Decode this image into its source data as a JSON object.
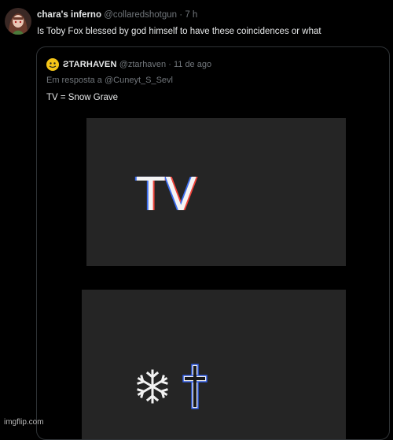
{
  "tweet": {
    "display_name": "chara's inferno",
    "handle": "@collaredshotgun",
    "separator": "·",
    "time": "7 h",
    "text": "Is Toby Fox blessed by god himself to have these coincidences or what"
  },
  "quote": {
    "display_name": "ƧTARHAVEN",
    "handle": "@ztarhaven",
    "separator": "·",
    "time": "11 de ago",
    "reply_to": "Em resposta a @Cuneyt_S_Sevl",
    "text": "TV = Snow Grave",
    "media": {
      "top_panel_text": "TV",
      "bottom_panel_icons": [
        "snowflake-icon",
        "cross-icon"
      ]
    }
  },
  "watermark": "imgflip.com",
  "colors": {
    "background": "#000000",
    "text_primary": "#e7e9ea",
    "text_secondary": "#71767b",
    "border": "#2f3336",
    "media_panel": "#252525"
  }
}
